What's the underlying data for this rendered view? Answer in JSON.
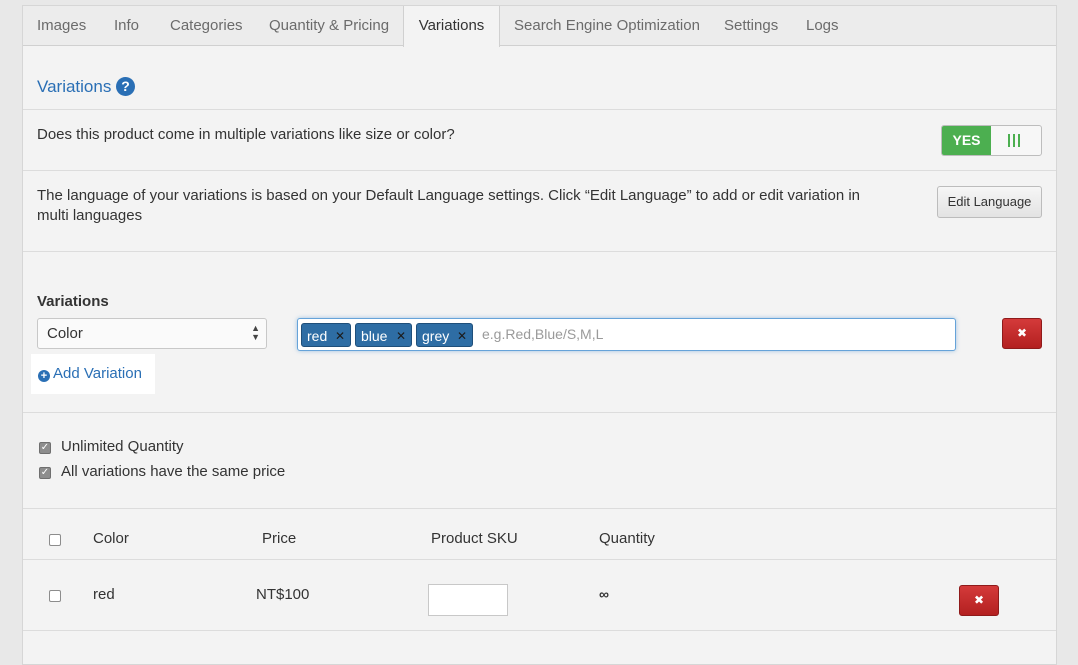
{
  "tabs": [
    "Images",
    "Info",
    "Categories",
    "Quantity & Pricing",
    "Variations",
    "Search Engine Optimization",
    "Settings",
    "Logs"
  ],
  "active_tab": "Variations",
  "section": {
    "title": "Variations"
  },
  "multi_variation": {
    "question": "Does this product come in multiple variations like size or color?",
    "toggle_label": "YES"
  },
  "language": {
    "line1": "The language of your variations is based on your Default Language settings. Click “Edit Language” to add or edit variation in",
    "line2": "multi languages",
    "button": "Edit Language"
  },
  "variations": {
    "label": "Variations",
    "type_selected": "Color",
    "tags": [
      "red",
      "blue",
      "grey"
    ],
    "placeholder": "e.g.Red,Blue/S,M,L",
    "remove_symbol": "✖",
    "add_label": "Add Variation"
  },
  "options": {
    "unlimited_quantity": "Unlimited Quantity",
    "same_price": "All variations have the same price"
  },
  "table": {
    "headers": [
      "Color",
      "Price",
      "Product SKU",
      "Quantity"
    ],
    "rows": [
      {
        "color": "red",
        "price": "NT$100",
        "sku": "",
        "quantity": "∞"
      }
    ]
  },
  "colors": {
    "link_blue": "#2a6fb5",
    "toggle_green": "#4caf50",
    "danger_red": "#b32020",
    "tag_blue": "#2e6da4"
  }
}
